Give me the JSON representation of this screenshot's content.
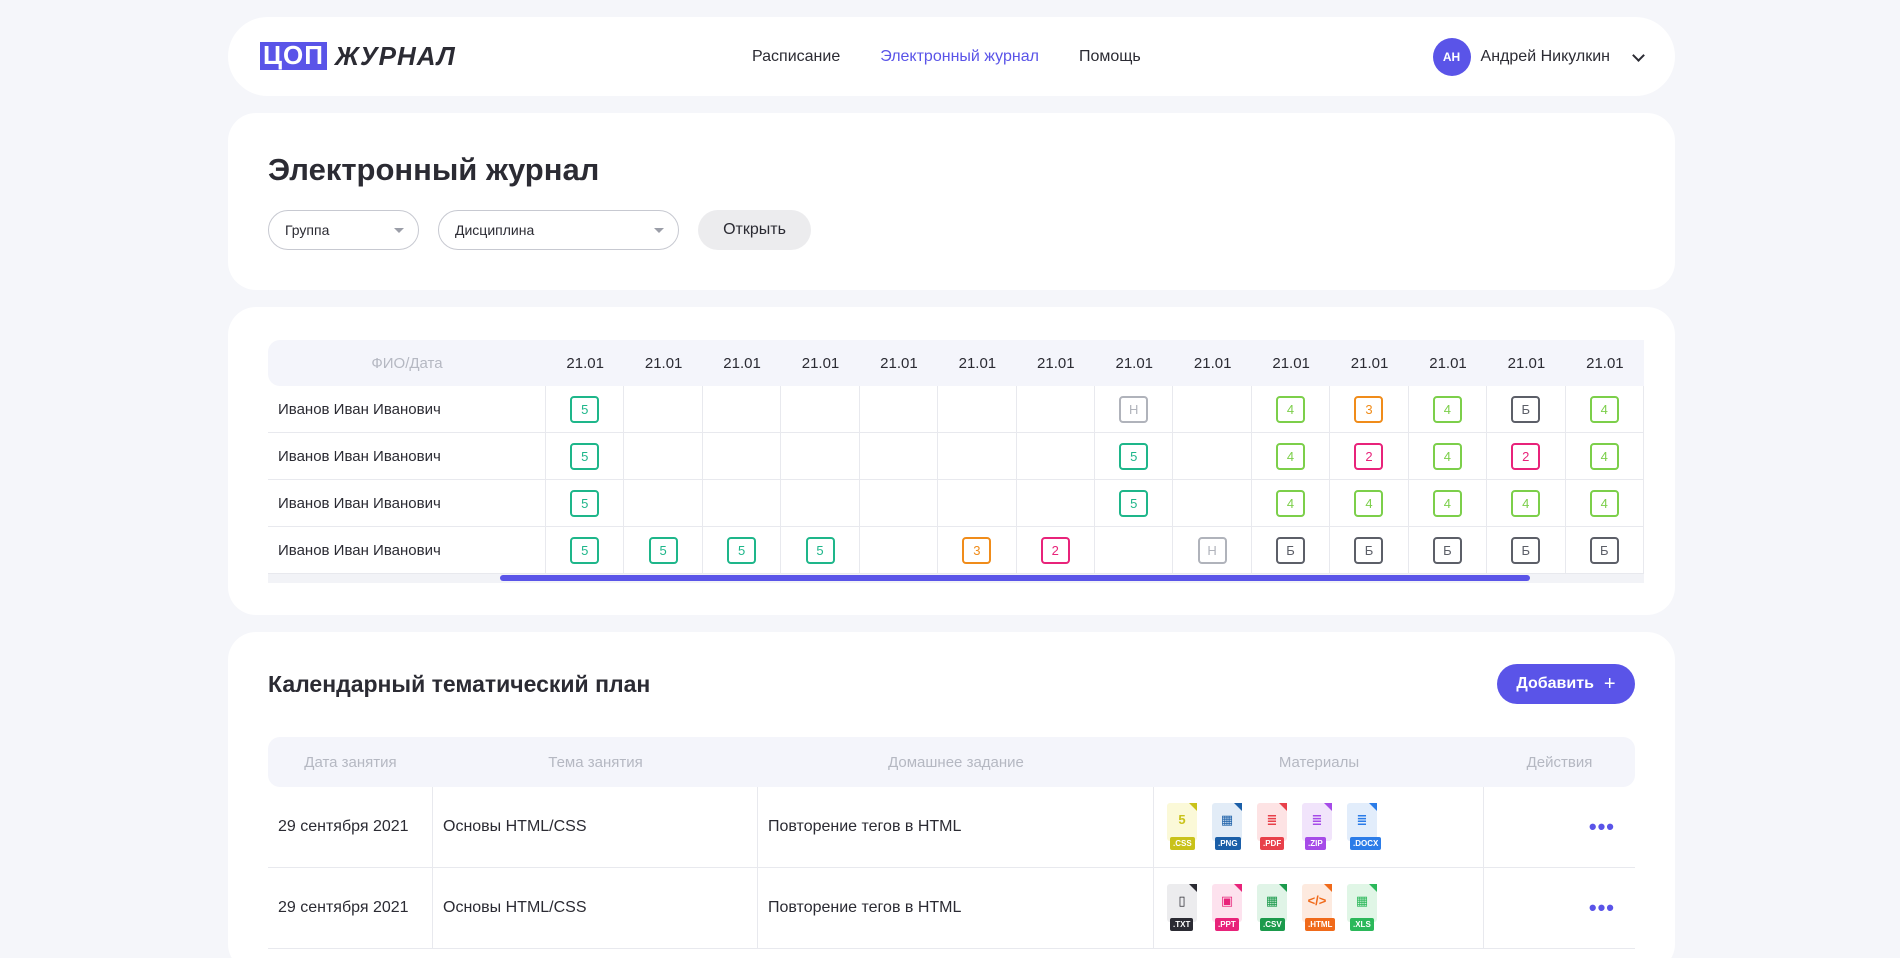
{
  "logo": {
    "box": "ЦОП",
    "word": "ЖУРНАЛ"
  },
  "nav": {
    "items": [
      "Расписание",
      "Электронный журнал",
      "Помощь"
    ],
    "active": "Электронный журнал"
  },
  "user": {
    "initials": "АН",
    "name": "Андрей Никулкин"
  },
  "journal": {
    "title": "Электронный журнал",
    "group_label": "Группа",
    "discipline_label": "Дисциплина",
    "open_label": "Открыть"
  },
  "grades": {
    "fio_header": "ФИО/Дата",
    "dates": [
      "21.01",
      "21.01",
      "21.01",
      "21.01",
      "21.01",
      "21.01",
      "21.01",
      "21.01",
      "21.01",
      "21.01",
      "21.01",
      "21.01",
      "21.01",
      "21.01"
    ],
    "rows": [
      {
        "name": "Иванов Иван Иванович",
        "marks": [
          "5",
          "",
          "",
          "",
          "",
          "",
          "",
          "Н",
          "",
          "4",
          "3",
          "4",
          "Б",
          "4"
        ]
      },
      {
        "name": "Иванов Иван Иванович",
        "marks": [
          "5",
          "",
          "",
          "",
          "",
          "",
          "",
          "5",
          "",
          "4",
          "2",
          "4",
          "2",
          "4"
        ]
      },
      {
        "name": "Иванов Иван Иванович",
        "marks": [
          "5",
          "",
          "",
          "",
          "",
          "",
          "",
          "5",
          "",
          "4",
          "4",
          "4",
          "4",
          "4"
        ]
      },
      {
        "name": "Иванов Иван Иванович",
        "marks": [
          "5",
          "5",
          "5",
          "5",
          "",
          "3",
          "2",
          "",
          "Н",
          "Б",
          "Б",
          "Б",
          "Б",
          "Б"
        ]
      }
    ],
    "mark_colors": {
      "5": "#1eb68a",
      "4": "#7ccf4a",
      "3": "#f08c1a",
      "2": "#e8237a",
      "Н": "#b0b3bb",
      "Б": "#5c5f68"
    }
  },
  "plan": {
    "title": "Календарный тематический план",
    "add_label": "Добавить",
    "headers": [
      "Дата занятия",
      "Тема занятия",
      "Домашнее задание",
      "Материалы",
      "Действия"
    ],
    "rows": [
      {
        "date": "29 сентября 2021",
        "topic": "Основы HTML/CSS",
        "homework": "Повторение тегов в HTML",
        "files": [
          {
            "ext": ".CSS",
            "icon": "css-file-icon",
            "glyph": "5",
            "color": "#c9c21a",
            "bg": "#fbf9d8"
          },
          {
            "ext": ".PNG",
            "icon": "png-file-icon",
            "glyph": "▦",
            "color": "#1b5fa8",
            "bg": "#e2ecf7"
          },
          {
            "ext": ".PDF",
            "icon": "pdf-file-icon",
            "glyph": "≣",
            "color": "#e8404a",
            "bg": "#fde3e4"
          },
          {
            "ext": ".ZIP",
            "icon": "zip-file-icon",
            "glyph": "≣",
            "color": "#a64be8",
            "bg": "#f1e4fb"
          },
          {
            "ext": ".DOCX",
            "icon": "docx-file-icon",
            "glyph": "≣",
            "color": "#2b7ce8",
            "bg": "#e2edfb"
          }
        ]
      },
      {
        "date": "29 сентября 2021",
        "topic": "Основы HTML/CSS",
        "homework": "Повторение тегов в HTML",
        "files": [
          {
            "ext": ".TXT",
            "icon": "txt-file-icon",
            "glyph": "▯",
            "color": "#2b2b33",
            "bg": "#ececee"
          },
          {
            "ext": ".PPT",
            "icon": "ppt-file-icon",
            "glyph": "▣",
            "color": "#e8237a",
            "bg": "#fde2ee"
          },
          {
            "ext": ".CSV",
            "icon": "csv-file-icon",
            "glyph": "▦",
            "color": "#1b9a4c",
            "bg": "#e0f4e7"
          },
          {
            "ext": ".HTML",
            "icon": "html-file-icon",
            "glyph": "</>",
            "color": "#f06a1a",
            "bg": "#fdeadf"
          },
          {
            "ext": ".XLS",
            "icon": "xls-file-icon",
            "glyph": "▦",
            "color": "#2bb85a",
            "bg": "#e0f6e6"
          }
        ]
      }
    ],
    "actions_glyph": "•••"
  }
}
